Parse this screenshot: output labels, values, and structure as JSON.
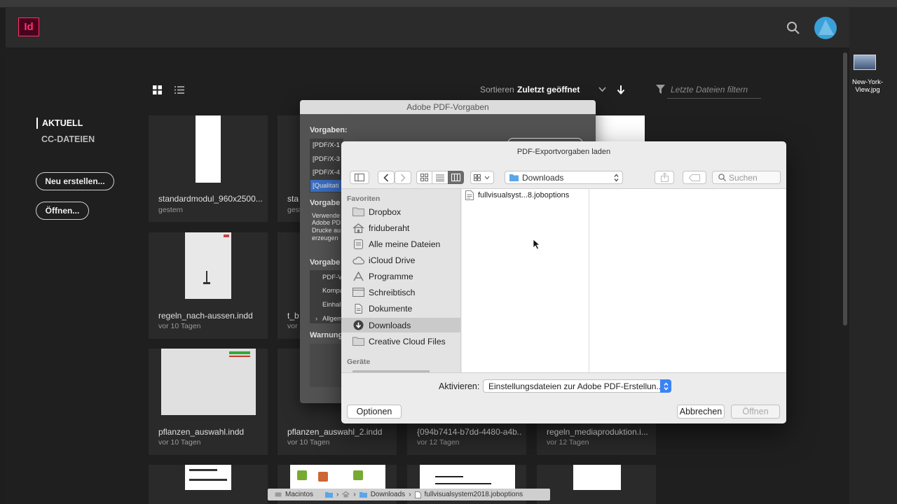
{
  "app": {
    "logo_text": "Id",
    "brand_color": "#ff3366",
    "accent_color": "#3aa0d8"
  },
  "sidebar": {
    "items": [
      {
        "label": "AKTUELL",
        "active": true
      },
      {
        "label": "CC-DATEIEN",
        "active": false
      }
    ],
    "new_button": "Neu erstellen...",
    "open_button": "Öffnen..."
  },
  "toolbar": {
    "sort_label": "Sortieren",
    "sort_value": "Zuletzt geöffnet",
    "filter_placeholder": "Letzte Dateien filtern"
  },
  "files": [
    {
      "name": "standardmodul_960x2500...",
      "date": "gestern"
    },
    {
      "name": "sta",
      "date": "gest"
    },
    {
      "name": "regeln_nach-aussen.indd",
      "date": "vor 10 Tagen"
    },
    {
      "name": "t_b",
      "date": "vor 1"
    },
    {
      "name": "pflanzen_auswahl.indd",
      "date": "vor 10 Tagen"
    },
    {
      "name": "pflanzen_auswahl_2.indd",
      "date": "vor 10 Tagen"
    },
    {
      "name": "{094b7414-b7dd-4480-a4b...",
      "date": "vor 12 Tagen"
    },
    {
      "name": "regeln_mediaproduktion.i...",
      "date": "vor 12 Tagen"
    }
  ],
  "vorgaben_dialog": {
    "title": "Adobe PDF-Vorgaben",
    "vorgaben_label": "Vorgaben:",
    "presets": [
      "[PDF/X-1",
      "[PDF/X-3",
      "[PDF/X-4",
      "[Qualitati"
    ],
    "beschreibung_label": "Vorgabe",
    "beschreibung_text": [
      "Verwende",
      "Adobe PD",
      "Drucke au",
      "erzeugen"
    ],
    "einstellungen_label": "Vorgabe",
    "einstellungen": [
      "PDF-V",
      "Kompa",
      "Einhal",
      "Allgem"
    ],
    "warnungen_label": "Warnung"
  },
  "open_sheet": {
    "title": "PDF-Exportvorgaben laden",
    "location": "Downloads",
    "search_placeholder": "Suchen",
    "favorites_label": "Favoriten",
    "favorites": [
      {
        "label": "Dropbox",
        "icon": "folder-icon"
      },
      {
        "label": "friduberaht",
        "icon": "home-icon"
      },
      {
        "label": "Alle meine Dateien",
        "icon": "all-files-icon"
      },
      {
        "label": "iCloud Drive",
        "icon": "cloud-icon"
      },
      {
        "label": "Programme",
        "icon": "applications-icon"
      },
      {
        "label": "Schreibtisch",
        "icon": "desktop-icon"
      },
      {
        "label": "Dokumente",
        "icon": "document-icon"
      },
      {
        "label": "Downloads",
        "icon": "download-icon",
        "selected": true
      },
      {
        "label": "Creative Cloud Files",
        "icon": "folder-icon"
      }
    ],
    "devices_label": "Geräte",
    "file": "fullvisualsyst...8.joboptions",
    "activate_label": "Aktivieren:",
    "activate_value": "Einstellungsdateien zur Adobe PDF-Erstellun...",
    "options_button": "Optionen",
    "cancel_button": "Abbrechen",
    "open_button": "Öffnen"
  },
  "pathbar": {
    "segments": [
      "Macintos",
      "Downloads",
      "fullvisualsystem2018.joboptions"
    ]
  },
  "desktop": {
    "file_label": "New-York-View.jpg"
  }
}
